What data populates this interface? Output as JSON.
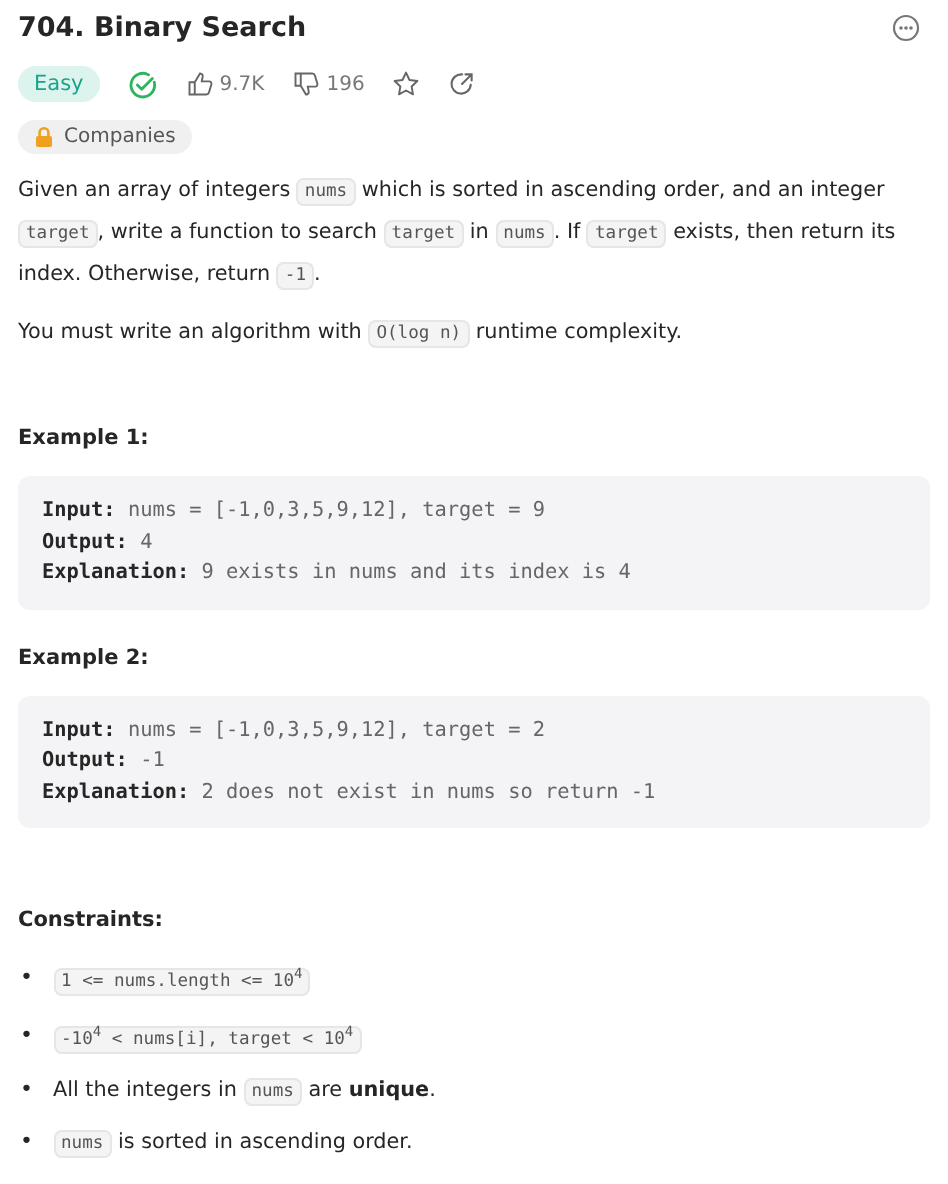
{
  "title": "704. Binary Search",
  "difficulty": "Easy",
  "solved": true,
  "likes": "9.7K",
  "dislikes": "196",
  "companies": "Companies",
  "description": [
    [
      {
        "kind": "text",
        "text": "Given an array of integers "
      },
      {
        "kind": "code",
        "text": "nums"
      },
      {
        "kind": "text",
        "text": " which is sorted in ascending order, and an integer "
      },
      {
        "kind": "code",
        "text": "target"
      },
      {
        "kind": "text",
        "text": ", write a function to search "
      },
      {
        "kind": "code",
        "text": "target"
      },
      {
        "kind": "text",
        "text": " in "
      },
      {
        "kind": "code",
        "text": "nums"
      },
      {
        "kind": "text",
        "text": ". If "
      },
      {
        "kind": "code",
        "text": "target"
      },
      {
        "kind": "text",
        "text": " exists, then return its index. Otherwise, return "
      },
      {
        "kind": "code",
        "text": "-1"
      },
      {
        "kind": "text",
        "text": "."
      }
    ],
    [
      {
        "kind": "text",
        "text": "You must write an algorithm with "
      },
      {
        "kind": "code",
        "text": "O(log n)"
      },
      {
        "kind": "text",
        "text": " runtime complexity."
      }
    ]
  ],
  "examples": [
    {
      "heading": "Example 1:",
      "lines": [
        "**Input:** nums = [-1,0,3,5,9,12], target = 9",
        "**Output:** 4",
        "**Explanation:** 9 exists in nums and its index is 4"
      ]
    },
    {
      "heading": "Example 2:",
      "lines": [
        "**Input:** nums = [-1,0,3,5,9,12], target = 2",
        "**Output:** -1",
        "**Explanation:** 2 does not exist in nums so return -1"
      ]
    }
  ],
  "constraints_heading": "Constraints:",
  "constraints": [
    {
      "bullet": "•",
      "parts": [
        {
          "kind": "code",
          "text": "1 <= nums.length <= 10$^{4}$"
        }
      ]
    },
    {
      "bullet": "•",
      "parts": [
        {
          "kind": "code",
          "text": "-10$^{4}$ < nums[i], target < 10$^{4}$"
        }
      ]
    },
    {
      "bullet": "•",
      "parts": [
        {
          "kind": "text",
          "text": "All the integers in "
        },
        {
          "kind": "code",
          "text": "nums"
        },
        {
          "kind": "text",
          "text": " are **unique**."
        }
      ]
    },
    {
      "bullet": "•",
      "parts": [
        {
          "kind": "code",
          "text": "nums"
        },
        {
          "kind": "text",
          "text": " is sorted in ascending order."
        }
      ]
    }
  ]
}
